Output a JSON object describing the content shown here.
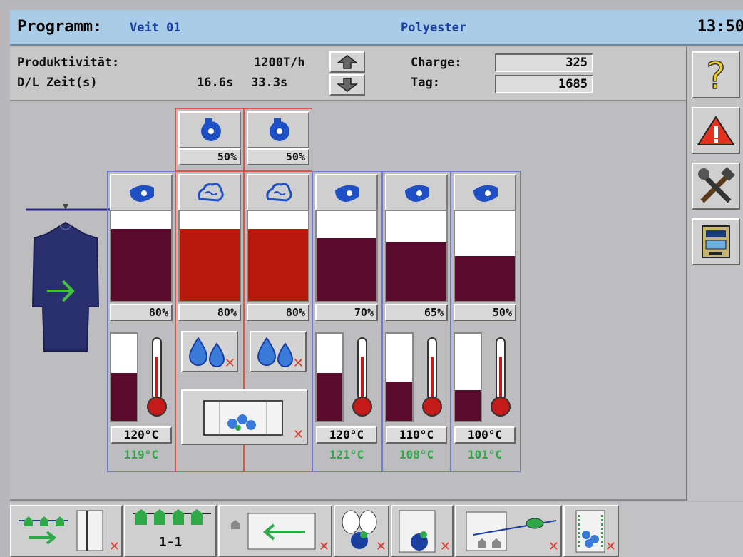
{
  "title": {
    "program_label": "Programm:",
    "program_name": "Veit 01",
    "material": "Polyester",
    "time": "13:50"
  },
  "info": {
    "productivity_label": "Produktivität:",
    "productivity_value": "1200T/h",
    "dl_label": "D/L Zeit(s)",
    "dl_value1": "16.6s",
    "dl_value2": "33.3s",
    "charge_label": "Charge:",
    "charge_value": "325",
    "tag_label": "Tag:",
    "tag_value": "1685"
  },
  "sidebar": {
    "help_icon": "question-icon",
    "warning_icon": "warning-icon",
    "tools_icon": "tools-icon",
    "cabinet_icon": "cabinet-icon"
  },
  "chambers": {
    "top_fans": [
      {
        "pct": "50%"
      },
      {
        "pct": "50%"
      }
    ],
    "columns": [
      {
        "icon": "fan-icon",
        "level": 0.8,
        "pct": "80%",
        "temp_level": 0.55,
        "set_temp": "120°C",
        "act_temp": "119°C",
        "color": "#5a0a2a"
      },
      {
        "icon": "steam-icon",
        "level": 0.8,
        "pct": "80%",
        "color": "#b8190d"
      },
      {
        "icon": "steam-icon",
        "level": 0.8,
        "pct": "80%",
        "color": "#b8190d"
      },
      {
        "icon": "fan-icon",
        "level": 0.7,
        "pct": "70%",
        "temp_level": 0.55,
        "set_temp": "120°C",
        "act_temp": "121°C",
        "color": "#5a0a2a"
      },
      {
        "icon": "fan-icon",
        "level": 0.65,
        "pct": "65%",
        "temp_level": 0.45,
        "set_temp": "110°C",
        "act_temp": "108°C",
        "color": "#5a0a2a"
      },
      {
        "icon": "fan-icon",
        "level": 0.5,
        "pct": "50%",
        "temp_level": 0.35,
        "set_temp": "100°C",
        "act_temp": "101°C",
        "color": "#5a0a2a"
      }
    ]
  },
  "bottom": {
    "buttons": [
      {
        "icon": "garment-entry-icon"
      },
      {
        "icon": "garment-rack-icon",
        "label": "1-1"
      },
      {
        "icon": "return-conveyor-icon"
      },
      {
        "icon": "fan-motor-icon"
      },
      {
        "icon": "cabinet-fan-icon"
      },
      {
        "icon": "conveyor-fan-icon"
      },
      {
        "icon": "water-tank-icon"
      }
    ]
  }
}
